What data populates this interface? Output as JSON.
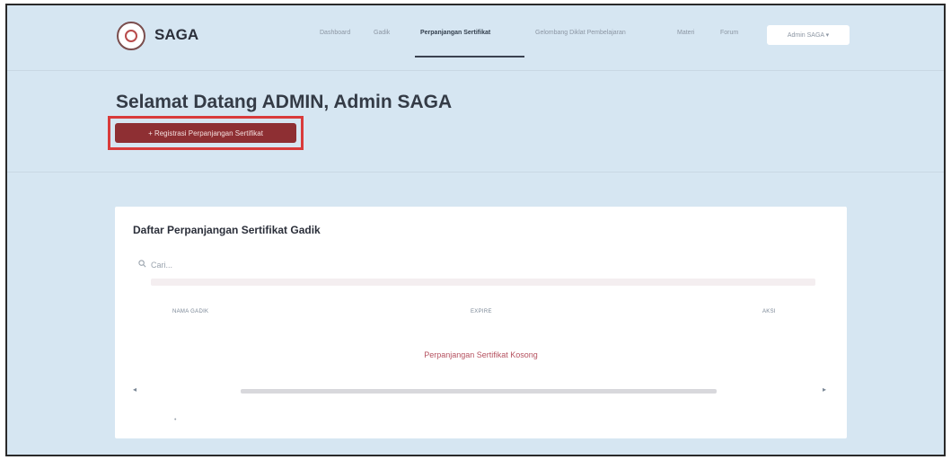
{
  "app": {
    "brand": "SAGA",
    "logo_icon": "seal-logo-icon"
  },
  "nav": {
    "links": [
      "Dashboard",
      "Gadik",
      "Perpanjangan Sertifikat",
      "Gelombang Diklat Pembelajaran",
      "Materi",
      "Forum"
    ],
    "active": "Perpanjangan Sertifikat",
    "user_menu": "Admin SAGA ▾"
  },
  "header": {
    "welcome": "Selamat Datang ADMIN, Admin SAGA",
    "register_button": "+ Registrasi Perpanjangan Sertifikat"
  },
  "card": {
    "title": "Daftar Perpanjangan Sertifikat Gadik",
    "search_placeholder": "Cari...",
    "columns": [
      "NAMA GADIK",
      "EXPIRE",
      "AKSI"
    ],
    "empty_message": "Perpanjangan Sertifikat Kosong"
  },
  "colors": {
    "background": "#d6e6f2",
    "primary_button": "#8e2f33",
    "highlight_border": "#d93b3b",
    "empty_text": "#b5515f"
  }
}
